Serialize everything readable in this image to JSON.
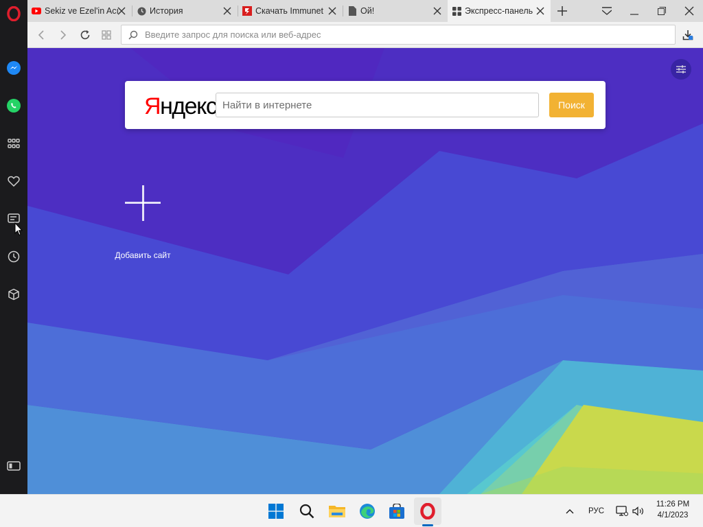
{
  "tabs": [
    {
      "title": "Sekiz ve Ezel'in Acı",
      "icon": "youtube-icon"
    },
    {
      "title": "История",
      "icon": "clock-icon"
    },
    {
      "title": "Скачать Immunet",
      "icon": "immunet-icon"
    },
    {
      "title": "Ой!",
      "icon": "page-icon"
    },
    {
      "title": "Экспресс-панель",
      "icon": "speed-dial-icon",
      "active": true
    }
  ],
  "address_bar": {
    "placeholder": "Введите запрос для поиска или веб-адрес",
    "value": ""
  },
  "yandex": {
    "logo_first": "Я",
    "logo_rest": "ндекс",
    "search_placeholder": "Найти в интернете",
    "search_button": "Поиск"
  },
  "speed_dial": {
    "add_site_label": "Добавить сайт"
  },
  "taskbar": {
    "language": "РУС",
    "time": "11:26 PM",
    "date": "4/1/2023"
  },
  "colors": {
    "opera_red": "#e01e2d",
    "yandex_button": "#f2b233",
    "taskbar_accent": "#0067c0"
  }
}
